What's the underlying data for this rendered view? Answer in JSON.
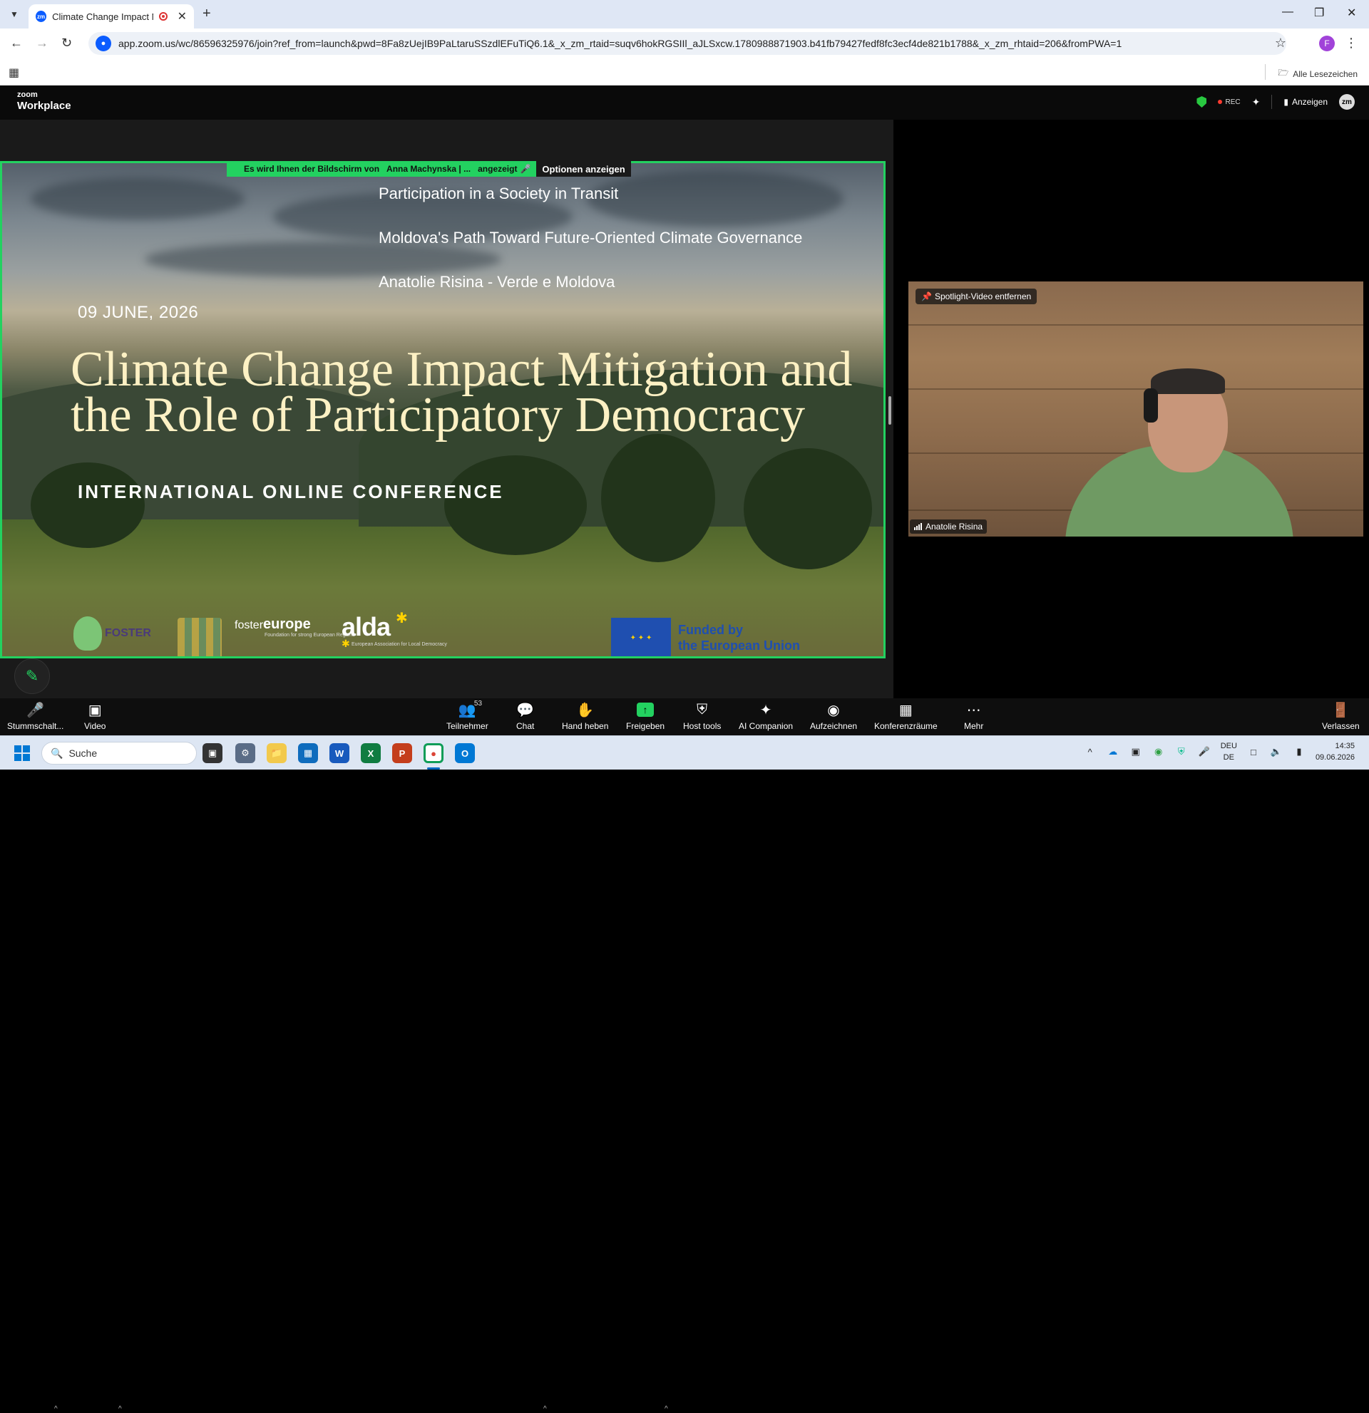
{
  "browser": {
    "tab_title": "Climate Change Impact Mit",
    "tab_favicon": "zm",
    "url": "app.zoom.us/wc/86596325976/join?ref_from=launch&pwd=8Fa8zUejIB9PaLtaruSSzdlEFuTiQ6.1&_x_zm_rtaid=suqv6hokRGSIIl_aJLSxcw.1780988871903.b41fb79427fedf8fc3ecf4de821b1788&_x_zm_rhtaid=206&fromPWA=1",
    "profile_initial": "F",
    "bookmarks_folder": "Alle Lesezeichen"
  },
  "zoom": {
    "logo_small": "zoom",
    "logo_big": "Workplace",
    "rec_label": "REC",
    "view_label": "Anzeigen",
    "avatar_label": "zm"
  },
  "share": {
    "banner_prefix": "Es wird Ihnen der Bildschirm von",
    "banner_presenter": "Anna Machynska | ...",
    "banner_suffix": "angezeigt",
    "options_label": "Optionen anzeigen"
  },
  "slide": {
    "line1": "Participation in a Society in Transit",
    "line2": "Moldova's Path Toward Future-Oriented Climate Governance",
    "line3": "Anatolie Risina - Verde e Moldova",
    "date": "09 JUNE, 2026",
    "title_line1": "Climate Change Impact Mitigation and",
    "title_line2": "the Role of Participatory Democracy",
    "subtitle": "INTERNATIONAL ONLINE CONFERENCE",
    "logo_foster": "FOSTER",
    "logo_fe_a": "foster",
    "logo_fe_b": "europe",
    "logo_fe_tag": "Foundation for strong European Regions",
    "logo_alda": "alda",
    "logo_alda_tag": "European Association for Local Democracy",
    "eu_line1": "Funded by",
    "eu_line2": "the European Union"
  },
  "video": {
    "spotlight_label": "Spotlight-Video entfernen",
    "participant_name": "Anatolie Risina"
  },
  "toolbar": {
    "mute": "Stummschalt...",
    "video": "Video",
    "participants": "Teilnehmer",
    "participants_count": "53",
    "chat": "Chat",
    "raise_hand": "Hand heben",
    "share": "Freigeben",
    "host_tools": "Host tools",
    "ai_companion": "AI Companion",
    "record": "Aufzeichnen",
    "breakout": "Konferenzräume",
    "more": "Mehr",
    "leave": "Verlassen"
  },
  "taskbar": {
    "search_placeholder": "Suche",
    "lang_line1": "DEU",
    "lang_line2": "DE",
    "time": "14:35",
    "date": "09.06.2026"
  },
  "colors": {
    "share_border": "#23d160",
    "zoom_blue": "#0b5cff",
    "title_cream": "#fdf1c4",
    "eu_blue": "#1f4fb0"
  }
}
